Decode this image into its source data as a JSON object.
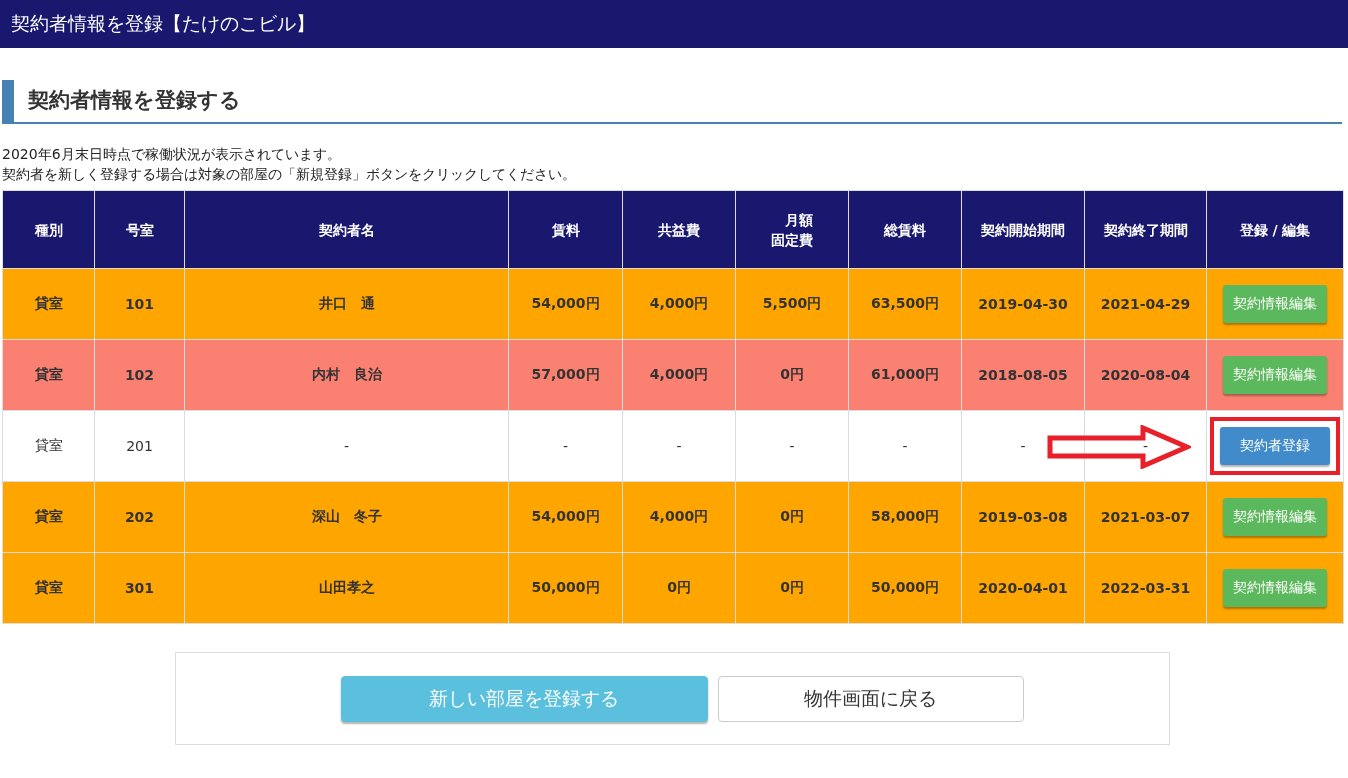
{
  "window": {
    "title": "契約者情報を登録【たけのこビル】"
  },
  "heading": "契約者情報を登録する",
  "notes": [
    "2020年6月末日時点で稼働状況が表示されています。",
    "契約者を新しく登録する場合は対象の部屋の「新規登録」ボタンをクリックしてください。"
  ],
  "table": {
    "columns": [
      "種別",
      "号室",
      "契約者名",
      "賃料",
      "共益費",
      "月額固定費",
      "総賃料",
      "契約開始期間",
      "契約終了期間",
      "登録 / 編集"
    ],
    "rows": [
      {
        "color": "#ffa500",
        "cells": [
          "貸室",
          "101",
          "井口　通",
          "54,000円",
          "4,000円",
          "5,500円",
          "63,500円",
          "2019-04-30",
          "2021-04-29"
        ],
        "action": {
          "kind": "edit",
          "label": "契約情報編集"
        },
        "annotated": false
      },
      {
        "color": "#fa8072",
        "cells": [
          "貸室",
          "102",
          "内村　良治",
          "57,000円",
          "4,000円",
          "0円",
          "61,000円",
          "2018-08-05",
          "2020-08-04"
        ],
        "action": {
          "kind": "edit",
          "label": "契約情報編集"
        },
        "annotated": false
      },
      {
        "color": "#ffffff",
        "cells": [
          "貸室",
          "201",
          "-",
          "-",
          "-",
          "-",
          "-",
          "-",
          "-"
        ],
        "action": {
          "kind": "register",
          "label": "契約者登録"
        },
        "annotated": true
      },
      {
        "color": "#ffa500",
        "cells": [
          "貸室",
          "202",
          "深山　冬子",
          "54,000円",
          "4,000円",
          "0円",
          "58,000円",
          "2019-03-08",
          "2021-03-07"
        ],
        "action": {
          "kind": "edit",
          "label": "契約情報編集"
        },
        "annotated": false
      },
      {
        "color": "#ffa500",
        "cells": [
          "貸室",
          "301",
          "山田孝之",
          "50,000円",
          "0円",
          "0円",
          "50,000円",
          "2020-04-01",
          "2022-03-31"
        ],
        "action": {
          "kind": "edit",
          "label": "契約情報編集"
        },
        "annotated": false
      }
    ]
  },
  "footer_buttons": [
    {
      "kind": "primary",
      "label": "新しい部屋を登録する"
    },
    {
      "kind": "secondary",
      "label": "物件画面に戻る"
    }
  ]
}
